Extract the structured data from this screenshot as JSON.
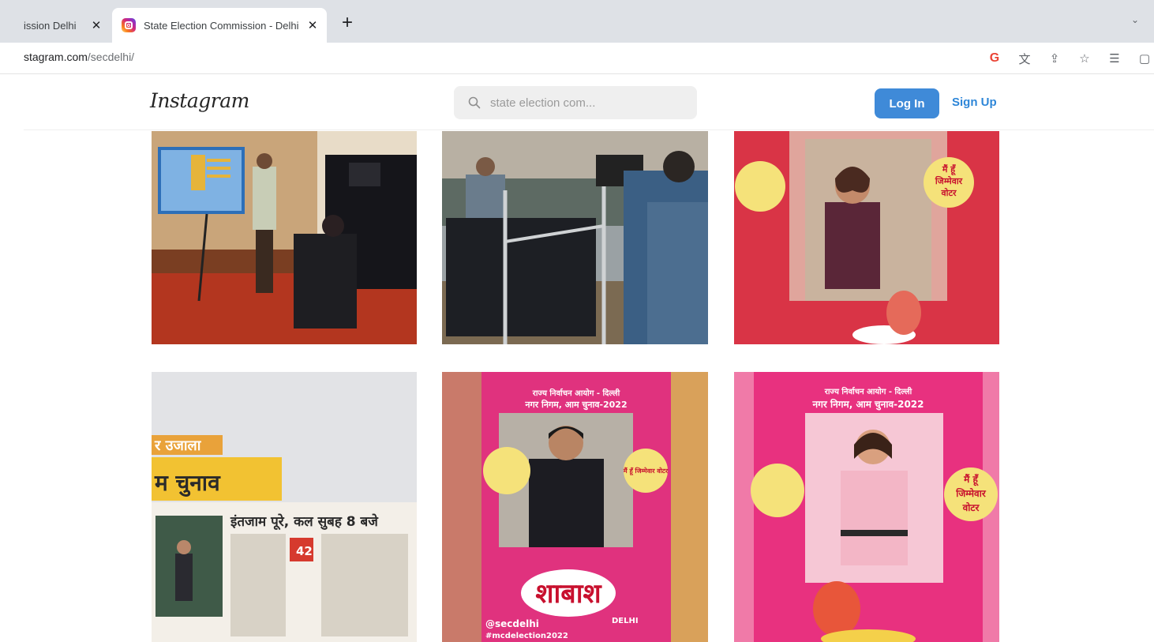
{
  "browser": {
    "tabs": [
      {
        "title": "ission Delhi",
        "active": false
      },
      {
        "title": "State Election Commission - Delhi",
        "active": true
      }
    ],
    "close_glyph": "✕",
    "new_tab_glyph": "+",
    "tab_menu_glyph": "⌄",
    "url_host": "stagram.com",
    "url_path": "/secdelhi/",
    "toolbar_icons": [
      "google-icon",
      "translate-icon",
      "share-icon",
      "bookmark-star-icon",
      "reading-list-icon",
      "side-panel-icon"
    ],
    "toolbar_glyphs": [
      "G",
      "文",
      "⇪",
      "☆",
      "☰",
      "▢"
    ]
  },
  "instagram": {
    "logo": "Instagram",
    "search": {
      "placeholder": "state election com..."
    },
    "login_label": "Log In",
    "signup_label": "Sign Up",
    "colors": {
      "login_bg": "#3f8ad8",
      "signup_text": "#2d86d8"
    }
  },
  "posts": [
    {
      "id": "post-1",
      "texts": []
    },
    {
      "id": "post-2",
      "texts": []
    },
    {
      "id": "post-3",
      "texts": [
        "मैं हूँ",
        "जिम्मेवार",
        "वोटर"
      ]
    },
    {
      "id": "post-4",
      "texts": [
        "र उजाला",
        "म चुनाव",
        "इंतजाम पूरे, कल सुबह 8 बजे",
        "42"
      ]
    },
    {
      "id": "post-5",
      "texts": [
        "राज्य निर्वाचन आयोग - दिल्ली",
        "नगर निगम, आम चुनाव-2022",
        "मैं हूँ जिम्मेवार वोटर",
        "शाबाश",
        "@secdelhi",
        "#mcdelection2022",
        "DELHI"
      ]
    },
    {
      "id": "post-6",
      "texts": [
        "राज्य निर्वाचन आयोग - दिल्ली",
        "नगर निगम, आम चुनाव-2022",
        "मैं हूँ",
        "जिम्मेवार",
        "वोटर"
      ]
    }
  ]
}
